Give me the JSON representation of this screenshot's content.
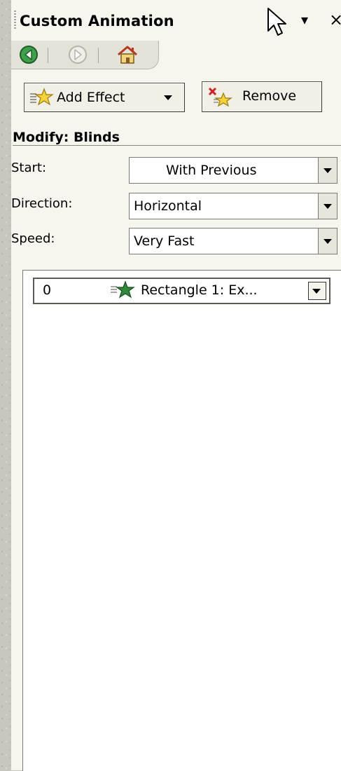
{
  "panel": {
    "title": "Custom Animation",
    "icons": {
      "cursor": "mouse-pointer-icon",
      "menu": "task-pane-menu-arrow-icon",
      "close": "close-icon"
    },
    "close_glyph": "×",
    "menu_glyph": "▾"
  },
  "nav": {
    "back": "back-arrow-icon",
    "forward": "forward-arrow-icon",
    "home": "home-icon"
  },
  "toolbar": {
    "add_effect_label": "Add Effect",
    "remove_label": "Remove"
  },
  "modify": {
    "title": "Modify: Blinds",
    "start_label": "Start:",
    "start_value": "With Previous",
    "direction_label": "Direction:",
    "direction_value": "Horizontal",
    "speed_label": "Speed:",
    "speed_value": "Very Fast"
  },
  "effects_list": {
    "items": [
      {
        "order": "0",
        "label": "Rectangle 1: Ex..."
      }
    ]
  },
  "colors": {
    "panel_bg": "#f6f5ee",
    "nav_bg": "#e3e1d8",
    "star_yellow": "#f3d23a",
    "star_green": "#2f8a3a",
    "remove_red": "#d22020"
  }
}
